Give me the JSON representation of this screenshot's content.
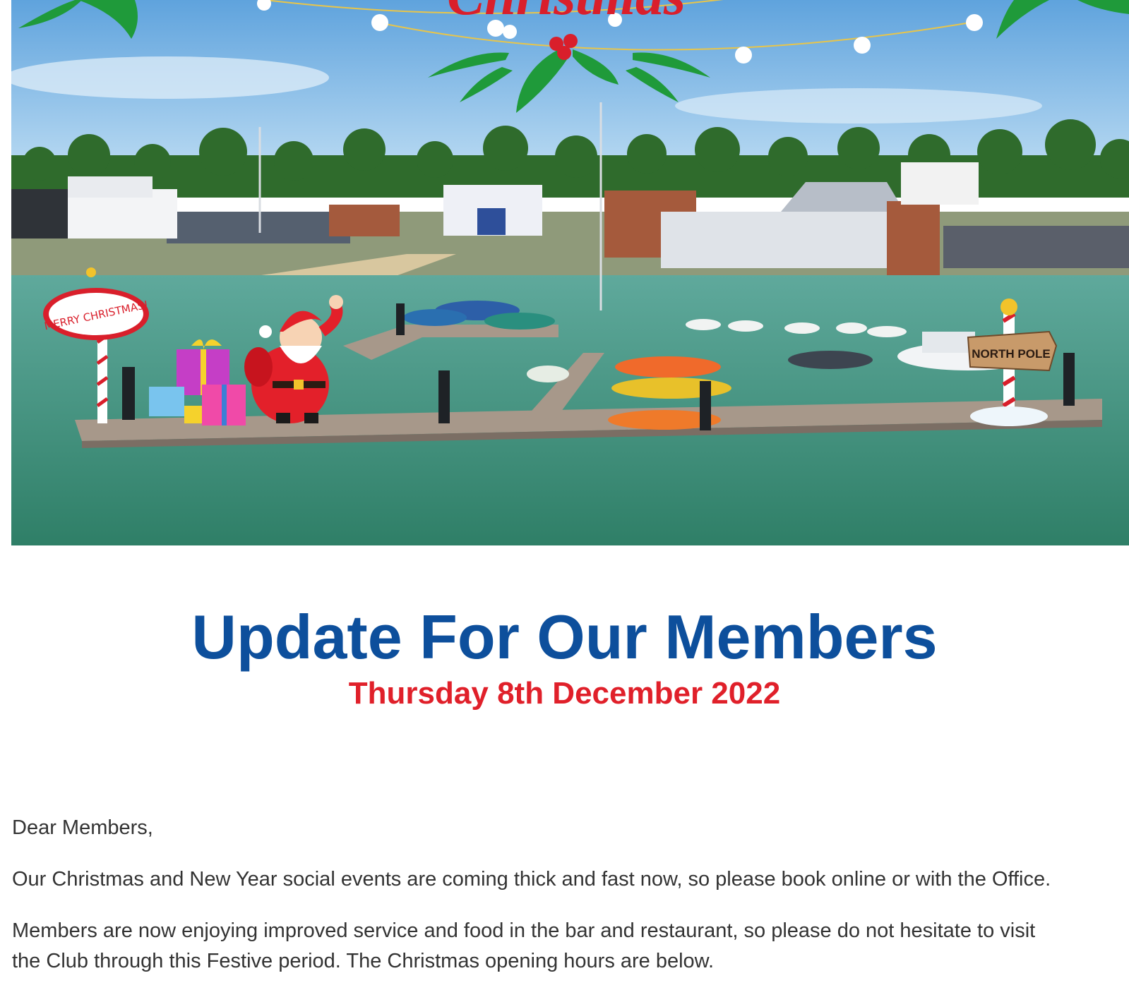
{
  "banner": {
    "script_heading": "Christmas",
    "sign_left": "MERRY CHRISTMAS!",
    "sign_right": "NORTH POLE"
  },
  "header": {
    "title": "Update For Our Members",
    "date": "Thursday 8th December 2022"
  },
  "letter": {
    "greeting": "Dear Members,",
    "paragraph_1": "Our Christmas and New Year social events are coming thick and fast now, so please book online or with the Office.",
    "paragraph_2_line_1": "Members are now enjoying improved service and food in the bar and restaurant, so please do not hesitate to visit",
    "paragraph_2_line_2": "the Club through this Festive period. The Christmas opening hours are below."
  },
  "colors": {
    "title_blue": "#0d4f9c",
    "date_red": "#e0202a",
    "body_text": "#333333"
  }
}
